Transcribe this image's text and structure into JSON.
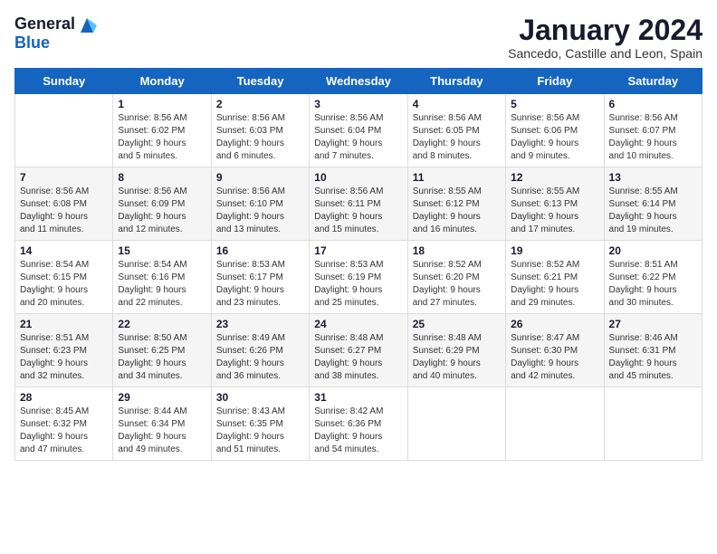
{
  "logo": {
    "general": "General",
    "blue": "Blue"
  },
  "title": "January 2024",
  "location": "Sancedo, Castille and Leon, Spain",
  "headers": [
    "Sunday",
    "Monday",
    "Tuesday",
    "Wednesday",
    "Thursday",
    "Friday",
    "Saturday"
  ],
  "weeks": [
    [
      {
        "day": "",
        "info": ""
      },
      {
        "day": "1",
        "info": "Sunrise: 8:56 AM\nSunset: 6:02 PM\nDaylight: 9 hours\nand 5 minutes."
      },
      {
        "day": "2",
        "info": "Sunrise: 8:56 AM\nSunset: 6:03 PM\nDaylight: 9 hours\nand 6 minutes."
      },
      {
        "day": "3",
        "info": "Sunrise: 8:56 AM\nSunset: 6:04 PM\nDaylight: 9 hours\nand 7 minutes."
      },
      {
        "day": "4",
        "info": "Sunrise: 8:56 AM\nSunset: 6:05 PM\nDaylight: 9 hours\nand 8 minutes."
      },
      {
        "day": "5",
        "info": "Sunrise: 8:56 AM\nSunset: 6:06 PM\nDaylight: 9 hours\nand 9 minutes."
      },
      {
        "day": "6",
        "info": "Sunrise: 8:56 AM\nSunset: 6:07 PM\nDaylight: 9 hours\nand 10 minutes."
      }
    ],
    [
      {
        "day": "7",
        "info": "Sunrise: 8:56 AM\nSunset: 6:08 PM\nDaylight: 9 hours\nand 11 minutes."
      },
      {
        "day": "8",
        "info": "Sunrise: 8:56 AM\nSunset: 6:09 PM\nDaylight: 9 hours\nand 12 minutes."
      },
      {
        "day": "9",
        "info": "Sunrise: 8:56 AM\nSunset: 6:10 PM\nDaylight: 9 hours\nand 13 minutes."
      },
      {
        "day": "10",
        "info": "Sunrise: 8:56 AM\nSunset: 6:11 PM\nDaylight: 9 hours\nand 15 minutes."
      },
      {
        "day": "11",
        "info": "Sunrise: 8:55 AM\nSunset: 6:12 PM\nDaylight: 9 hours\nand 16 minutes."
      },
      {
        "day": "12",
        "info": "Sunrise: 8:55 AM\nSunset: 6:13 PM\nDaylight: 9 hours\nand 17 minutes."
      },
      {
        "day": "13",
        "info": "Sunrise: 8:55 AM\nSunset: 6:14 PM\nDaylight: 9 hours\nand 19 minutes."
      }
    ],
    [
      {
        "day": "14",
        "info": "Sunrise: 8:54 AM\nSunset: 6:15 PM\nDaylight: 9 hours\nand 20 minutes."
      },
      {
        "day": "15",
        "info": "Sunrise: 8:54 AM\nSunset: 6:16 PM\nDaylight: 9 hours\nand 22 minutes."
      },
      {
        "day": "16",
        "info": "Sunrise: 8:53 AM\nSunset: 6:17 PM\nDaylight: 9 hours\nand 23 minutes."
      },
      {
        "day": "17",
        "info": "Sunrise: 8:53 AM\nSunset: 6:19 PM\nDaylight: 9 hours\nand 25 minutes."
      },
      {
        "day": "18",
        "info": "Sunrise: 8:52 AM\nSunset: 6:20 PM\nDaylight: 9 hours\nand 27 minutes."
      },
      {
        "day": "19",
        "info": "Sunrise: 8:52 AM\nSunset: 6:21 PM\nDaylight: 9 hours\nand 29 minutes."
      },
      {
        "day": "20",
        "info": "Sunrise: 8:51 AM\nSunset: 6:22 PM\nDaylight: 9 hours\nand 30 minutes."
      }
    ],
    [
      {
        "day": "21",
        "info": "Sunrise: 8:51 AM\nSunset: 6:23 PM\nDaylight: 9 hours\nand 32 minutes."
      },
      {
        "day": "22",
        "info": "Sunrise: 8:50 AM\nSunset: 6:25 PM\nDaylight: 9 hours\nand 34 minutes."
      },
      {
        "day": "23",
        "info": "Sunrise: 8:49 AM\nSunset: 6:26 PM\nDaylight: 9 hours\nand 36 minutes."
      },
      {
        "day": "24",
        "info": "Sunrise: 8:48 AM\nSunset: 6:27 PM\nDaylight: 9 hours\nand 38 minutes."
      },
      {
        "day": "25",
        "info": "Sunrise: 8:48 AM\nSunset: 6:29 PM\nDaylight: 9 hours\nand 40 minutes."
      },
      {
        "day": "26",
        "info": "Sunrise: 8:47 AM\nSunset: 6:30 PM\nDaylight: 9 hours\nand 42 minutes."
      },
      {
        "day": "27",
        "info": "Sunrise: 8:46 AM\nSunset: 6:31 PM\nDaylight: 9 hours\nand 45 minutes."
      }
    ],
    [
      {
        "day": "28",
        "info": "Sunrise: 8:45 AM\nSunset: 6:32 PM\nDaylight: 9 hours\nand 47 minutes."
      },
      {
        "day": "29",
        "info": "Sunrise: 8:44 AM\nSunset: 6:34 PM\nDaylight: 9 hours\nand 49 minutes."
      },
      {
        "day": "30",
        "info": "Sunrise: 8:43 AM\nSunset: 6:35 PM\nDaylight: 9 hours\nand 51 minutes."
      },
      {
        "day": "31",
        "info": "Sunrise: 8:42 AM\nSunset: 6:36 PM\nDaylight: 9 hours\nand 54 minutes."
      },
      {
        "day": "",
        "info": ""
      },
      {
        "day": "",
        "info": ""
      },
      {
        "day": "",
        "info": ""
      }
    ]
  ]
}
